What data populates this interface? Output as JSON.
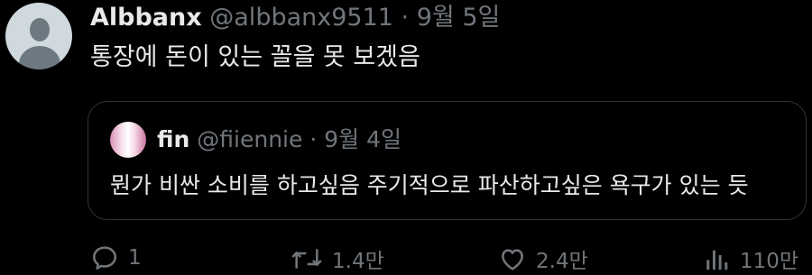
{
  "tweet": {
    "display_name": "Albbanx",
    "handle": "@albbanx9511",
    "separator": "·",
    "date": "9월 5일",
    "text": "통장에 돈이 있는 꼴을 못 보겠음"
  },
  "quoted_tweet": {
    "display_name": "fin",
    "handle": "@fiiennie",
    "separator": "·",
    "date": "9월 4일",
    "text": "뭔가 비싼 소비를 하고싶음 주기적으로 파산하고싶은 욕구가 있는 듯"
  },
  "actions": {
    "reply_count": "1",
    "retweet_count": "1.4만",
    "like_count": "2.4만",
    "views_count": "110만"
  },
  "icons": {
    "reply": "reply-icon",
    "retweet": "retweet-icon",
    "like": "heart-icon",
    "views": "views-icon"
  },
  "colors": {
    "background": "#000000",
    "primary_text": "#e7e9ea",
    "secondary_text": "#71767b",
    "border": "#2f3336"
  }
}
